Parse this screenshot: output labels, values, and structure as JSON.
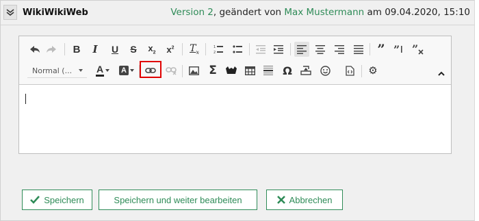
{
  "header": {
    "title": "WikiWikiWeb",
    "version_link": "Version 2",
    "changed_by_text": ", geändert von ",
    "author": "Max Mustermann",
    "date_text": " am 09.04.2020, 15:10"
  },
  "toolbar": {
    "format_label": "Normal (...",
    "highlighted_button": "link-button"
  },
  "actions": {
    "save": "Speichern",
    "save_continue": "Speichern und weiter bearbeiten",
    "cancel": "Abbrechen"
  },
  "colors": {
    "accent": "#2e8b57",
    "highlight": "#e00000"
  }
}
